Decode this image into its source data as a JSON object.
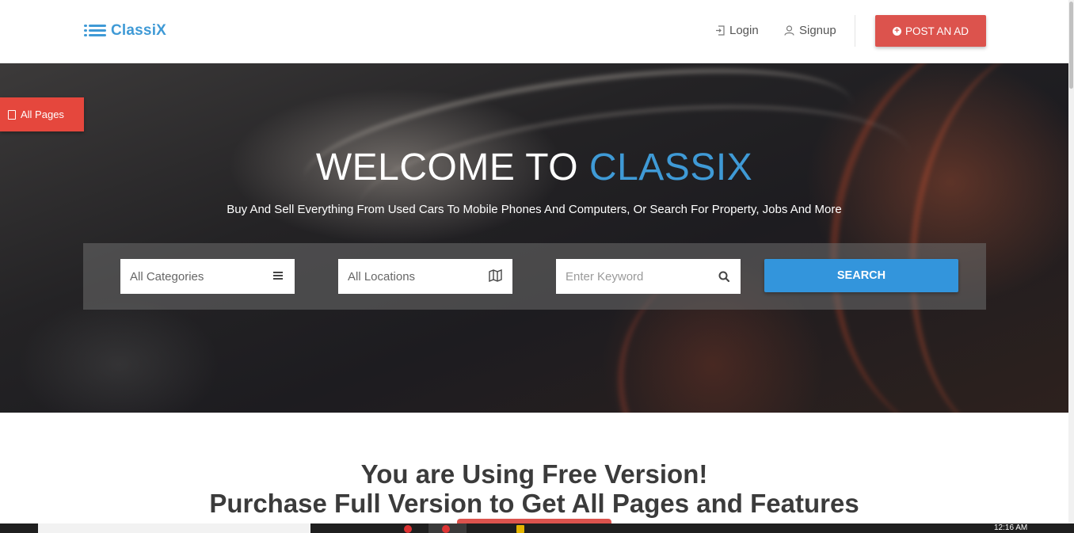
{
  "brand": {
    "name": "ClassiX",
    "accent": "#3f9ad6"
  },
  "header": {
    "login": "Login",
    "signup": "Signup",
    "post_ad": "POST AN AD"
  },
  "side_tab": {
    "label": "All Pages"
  },
  "hero": {
    "title_main": "WELCOME TO ",
    "title_accent": "CLASSIX",
    "subtitle": "Buy And Sell Everything From Used Cars To Mobile Phones And Computers, Or Search For Property, Jobs And More"
  },
  "search": {
    "categories": "All Categories",
    "locations": "All Locations",
    "keyword_placeholder": "Enter Keyword",
    "button": "SEARCH"
  },
  "promo": {
    "line1": "You are Using Free Version!",
    "line2": "Purchase Full Version to Get All Pages and Features"
  },
  "taskbar": {
    "time": "12:16 AM"
  },
  "colors": {
    "red": "#dc534d",
    "blue_button": "#3395dc",
    "side_tab": "#e5473d"
  },
  "icons": [
    "list-icon",
    "login-icon",
    "user-icon",
    "plus-circle-icon",
    "document-icon",
    "menu-icon",
    "map-icon",
    "search-icon"
  ]
}
